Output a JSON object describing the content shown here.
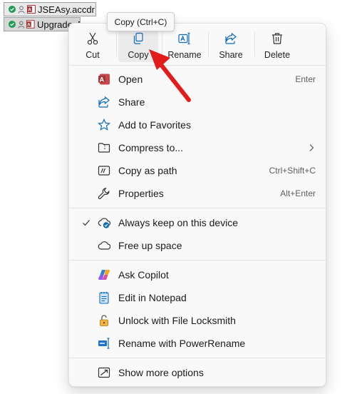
{
  "background_files": [
    {
      "name": "JSEAsy.accdr"
    },
    {
      "name": "Upgrade_Data.fi"
    }
  ],
  "tooltip": {
    "text": "Copy (Ctrl+C)"
  },
  "toolbar": {
    "cut": "Cut",
    "copy": "Copy",
    "rename": "Rename",
    "share": "Share",
    "delete": "Delete"
  },
  "menu": {
    "open": {
      "label": "Open",
      "shortcut": "Enter"
    },
    "share": {
      "label": "Share"
    },
    "favorites": {
      "label": "Add to Favorites"
    },
    "compress": {
      "label": "Compress to..."
    },
    "copy_path": {
      "label": "Copy as path",
      "shortcut": "Ctrl+Shift+C"
    },
    "properties": {
      "label": "Properties",
      "shortcut": "Alt+Enter"
    },
    "keep": {
      "label": "Always keep on this device",
      "checked": true
    },
    "free_space": {
      "label": "Free up space"
    },
    "copilot": {
      "label": "Ask Copilot"
    },
    "notepad": {
      "label": "Edit in Notepad"
    },
    "locksmith": {
      "label": "Unlock with File Locksmith"
    },
    "powerrename": {
      "label": "Rename with PowerRename"
    },
    "more": {
      "label": "Show more options"
    }
  },
  "colors": {
    "access_red": "#a4373a",
    "accent_blue": "#0f6cbd",
    "arrow_red": "#e21b1b",
    "check_green": "#1f9d55"
  }
}
